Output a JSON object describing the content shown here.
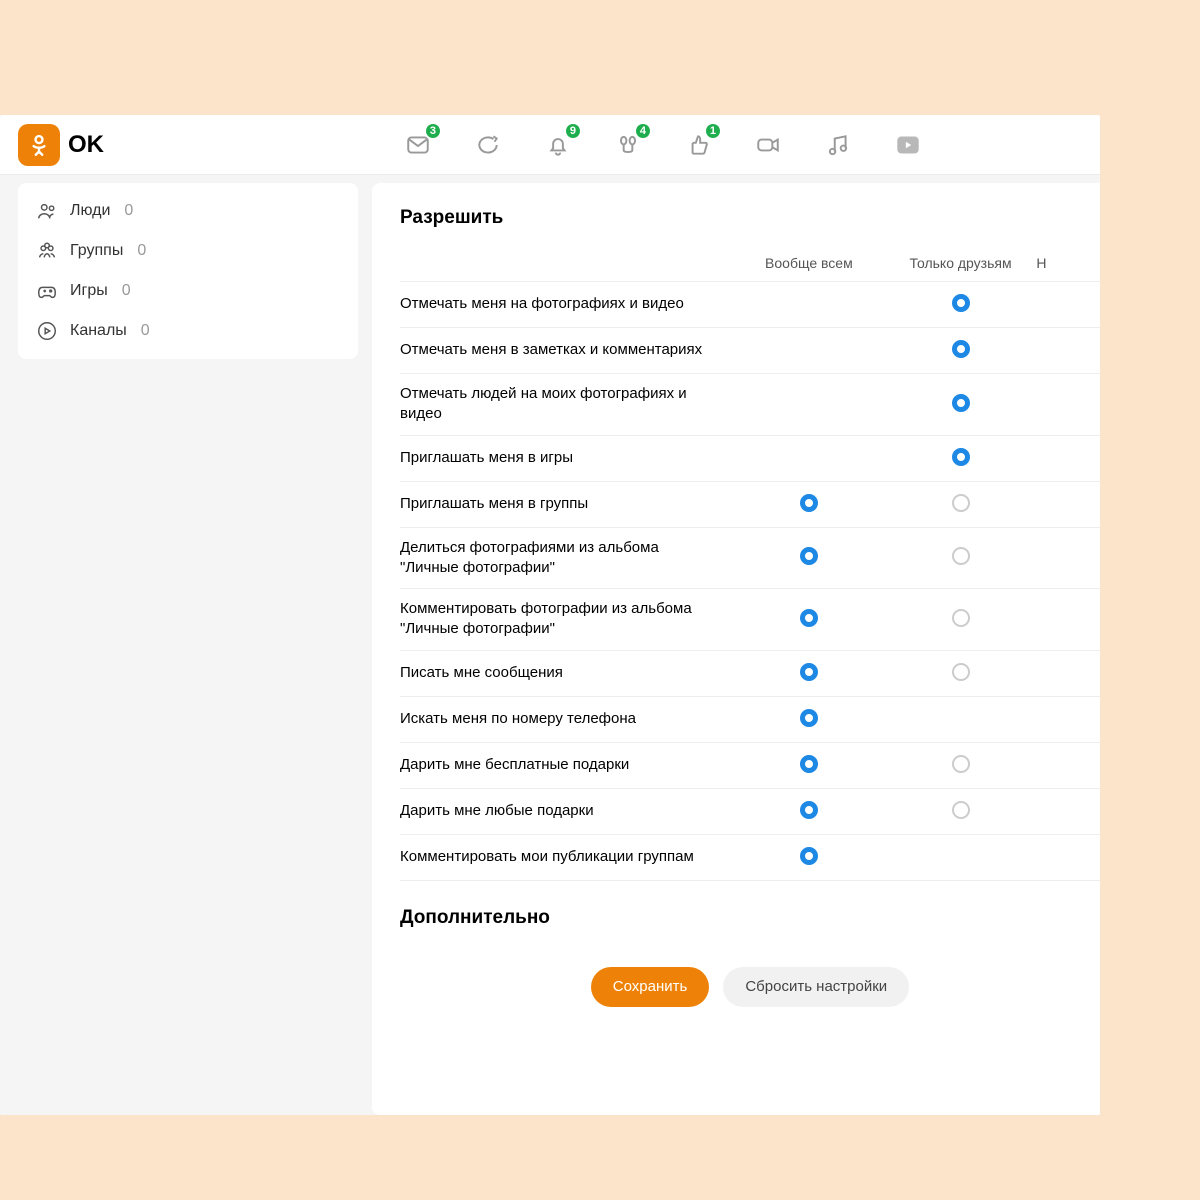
{
  "brand": {
    "name": "OK"
  },
  "header": {
    "icons": [
      {
        "name": "messages-icon",
        "badge": "3"
      },
      {
        "name": "discussions-icon",
        "badge": null
      },
      {
        "name": "notifications-icon",
        "badge": "9"
      },
      {
        "name": "guests-icon",
        "badge": "4"
      },
      {
        "name": "likes-icon",
        "badge": "1"
      },
      {
        "name": "video-icon",
        "badge": null
      },
      {
        "name": "music-icon",
        "badge": null
      },
      {
        "name": "play-icon",
        "badge": null
      }
    ]
  },
  "sidebar": {
    "items": [
      {
        "label": "Люди",
        "count": "0",
        "icon": "people-icon"
      },
      {
        "label": "Группы",
        "count": "0",
        "icon": "groups-icon"
      },
      {
        "label": "Игры",
        "count": "0",
        "icon": "games-icon"
      },
      {
        "label": "Каналы",
        "count": "0",
        "icon": "channels-icon"
      }
    ]
  },
  "permissions": {
    "title": "Разрешить",
    "columns": {
      "all": "Вообще всем",
      "friends": "Только друзьям",
      "third": "Н"
    },
    "rows": [
      {
        "label": "Отмечать меня на фотографиях и видео",
        "sel": 1,
        "show1": false
      },
      {
        "label": "Отмечать меня в заметках и комментариях",
        "sel": 1,
        "show1": false
      },
      {
        "label": "Отмечать людей на моих фотографиях и видео",
        "sel": 1,
        "show1": false
      },
      {
        "label": "Приглашать меня в игры",
        "sel": 1,
        "show1": false
      },
      {
        "label": "Приглашать меня в группы",
        "sel": 0,
        "show1": true
      },
      {
        "label": "Делиться фотографиями из альбома \"Личные фотографии\"",
        "sel": 0,
        "show1": true
      },
      {
        "label": "Комментировать фотографии из альбома \"Личные фотографии\"",
        "sel": 0,
        "show1": true
      },
      {
        "label": "Писать мне сообщения",
        "sel": 0,
        "show1": true
      },
      {
        "label": "Искать меня по номеру телефона",
        "sel": 0,
        "show1": false
      },
      {
        "label": "Дарить мне бесплатные подарки",
        "sel": 0,
        "show1": true
      },
      {
        "label": "Дарить мне любые подарки",
        "sel": 0,
        "show1": true
      },
      {
        "label": "Комментировать мои публикации группам",
        "sel": 0,
        "show1": false
      }
    ]
  },
  "additional": {
    "title": "Дополнительно"
  },
  "buttons": {
    "save": "Сохранить",
    "reset": "Сбросить настройки"
  }
}
